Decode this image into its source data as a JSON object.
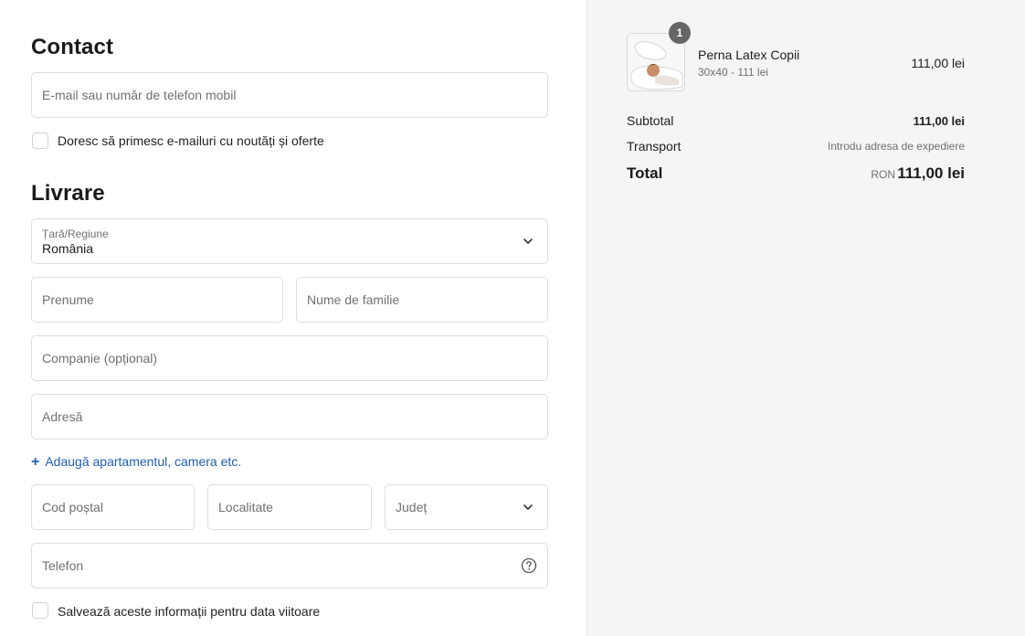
{
  "contact": {
    "heading": "Contact",
    "email_placeholder": "E-mail sau număr de telefon mobil",
    "newsletter_label": "Doresc să primesc e-mailuri cu noutăți și oferte"
  },
  "delivery": {
    "heading": "Livrare",
    "country_label": "Țară/Regiune",
    "country_value": "România",
    "first_name_placeholder": "Prenume",
    "last_name_placeholder": "Nume de familie",
    "company_placeholder": "Companie (opțional)",
    "address_placeholder": "Adresă",
    "add_apartment_label": "Adaugă apartamentul, camera etc.",
    "postal_code_placeholder": "Cod poștal",
    "city_placeholder": "Localitate",
    "county_placeholder": "Județ",
    "phone_placeholder": "Telefon",
    "save_info_label": "Salvează aceste informații pentru data viitoare"
  },
  "summary": {
    "item": {
      "quantity": "1",
      "name": "Perna Latex Copii",
      "variant": "30x40 - 111 lei",
      "price": "111,00 lei"
    },
    "subtotal_label": "Subtotal",
    "subtotal_value": "111,00 lei",
    "shipping_label": "Transport",
    "shipping_value": "Introdu adresa de expediere",
    "total_label": "Total",
    "currency": "RON",
    "total_value": "111,00 lei"
  },
  "colors": {
    "link": "#1f5eb0",
    "summary_bg": "#f5f5f5",
    "badge": "#666666"
  },
  "icons": {
    "chevron": "chevron-down-icon",
    "help": "question-circle-icon",
    "plus": "plus-icon"
  }
}
